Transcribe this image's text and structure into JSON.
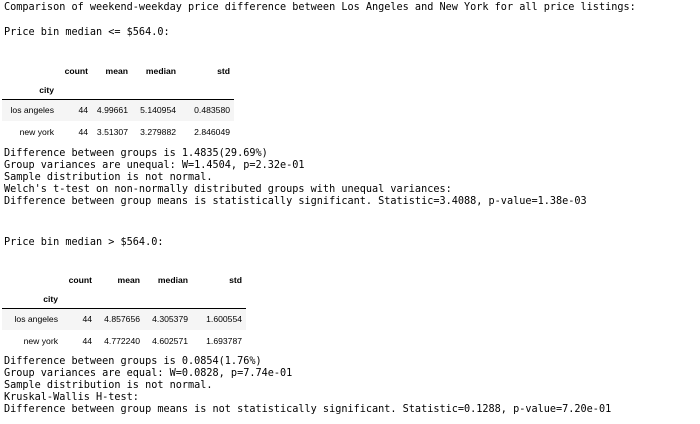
{
  "heading": "Comparison of weekend-weekday price difference between Los Angeles and New York for all price listings:",
  "section1": {
    "title": "Price bin median <= $564.0:",
    "table": {
      "columns": [
        "count",
        "mean",
        "median",
        "std"
      ],
      "index_name": "city",
      "rows": [
        {
          "city": "los angeles",
          "count": "44",
          "mean": "4.99661",
          "median": "5.140954",
          "std": "0.483580"
        },
        {
          "city": "new york",
          "count": "44",
          "mean": "3.51307",
          "median": "3.279882",
          "std": "2.846049"
        }
      ]
    },
    "output": [
      "Difference between groups is 1.4835(29.69%)",
      "Group variances are unequal: W=1.4504, p=2.32e-01",
      "Sample distribution is not normal.",
      "Welch's t-test on non-normally distributed groups with unequal variances:",
      "Difference between group means is statistically significant. Statistic=3.4088, p-value=1.38e-03"
    ]
  },
  "section2": {
    "title": "Price bin median > $564.0:",
    "table": {
      "columns": [
        "count",
        "mean",
        "median",
        "std"
      ],
      "index_name": "city",
      "rows": [
        {
          "city": "los angeles",
          "count": "44",
          "mean": "4.857656",
          "median": "4.305379",
          "std": "1.600554"
        },
        {
          "city": "new york",
          "count": "44",
          "mean": "4.772240",
          "median": "4.602571",
          "std": "1.693787"
        }
      ]
    },
    "output": [
      "Difference between groups is 0.0854(1.76%)",
      "Group variances are equal: W=0.0828, p=7.74e-01",
      "Sample distribution is not normal.",
      "Kruskal-Wallis H-test:",
      "Difference between group means is not statistically significant. Statistic=0.1288, p-value=7.20e-01"
    ]
  }
}
